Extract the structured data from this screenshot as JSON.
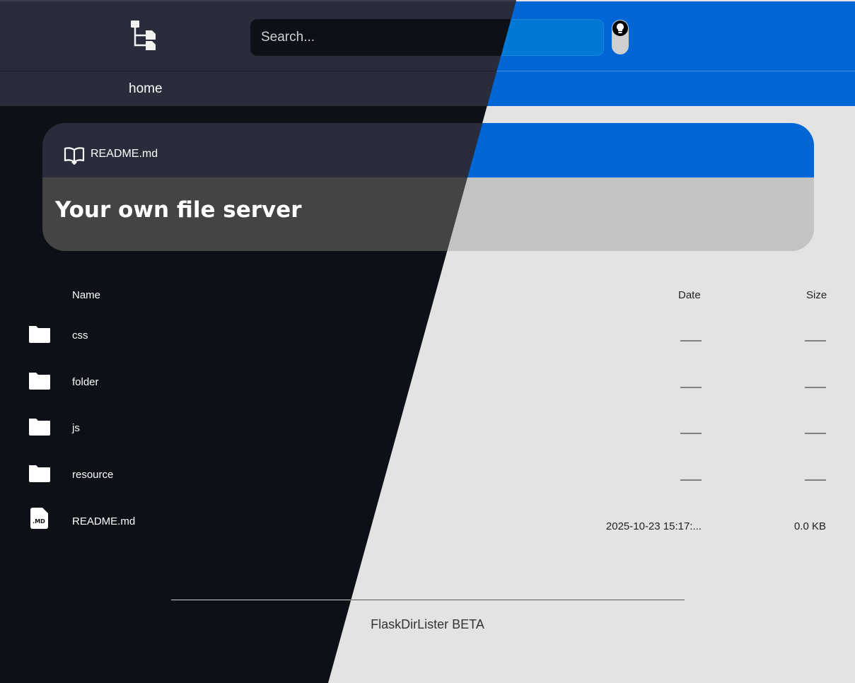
{
  "header": {
    "logo_icon": "tree-structure-icon",
    "search_placeholder": "Search...",
    "theme_toggle_icon": "lightbulb-icon"
  },
  "nav": {
    "home_label": "home"
  },
  "readme": {
    "file_icon": "book-open-icon",
    "file_name": "README.md",
    "title": "Your own file server"
  },
  "table": {
    "columns": {
      "name": "Name",
      "date": "Date",
      "size": "Size"
    },
    "rows": [
      {
        "icon": "folder-icon",
        "name": "css",
        "date": "——",
        "size": "——"
      },
      {
        "icon": "folder-icon",
        "name": "folder",
        "date": "——",
        "size": "——"
      },
      {
        "icon": "folder-icon",
        "name": "js",
        "date": "——",
        "size": "——"
      },
      {
        "icon": "folder-icon",
        "name": "resource",
        "date": "——",
        "size": "——"
      },
      {
        "icon": "md-file-icon",
        "name": "README.md",
        "date": "2025-10-23 15:17:...",
        "size": "0.0 KB"
      }
    ]
  },
  "footer": {
    "text": "FlaskDirLister BETA"
  },
  "colors": {
    "dark_bg": "#0e1018",
    "dark_panel": "#2a2c3c",
    "light_bg": "#e3e3e3",
    "light_accent": "#0066d6"
  }
}
